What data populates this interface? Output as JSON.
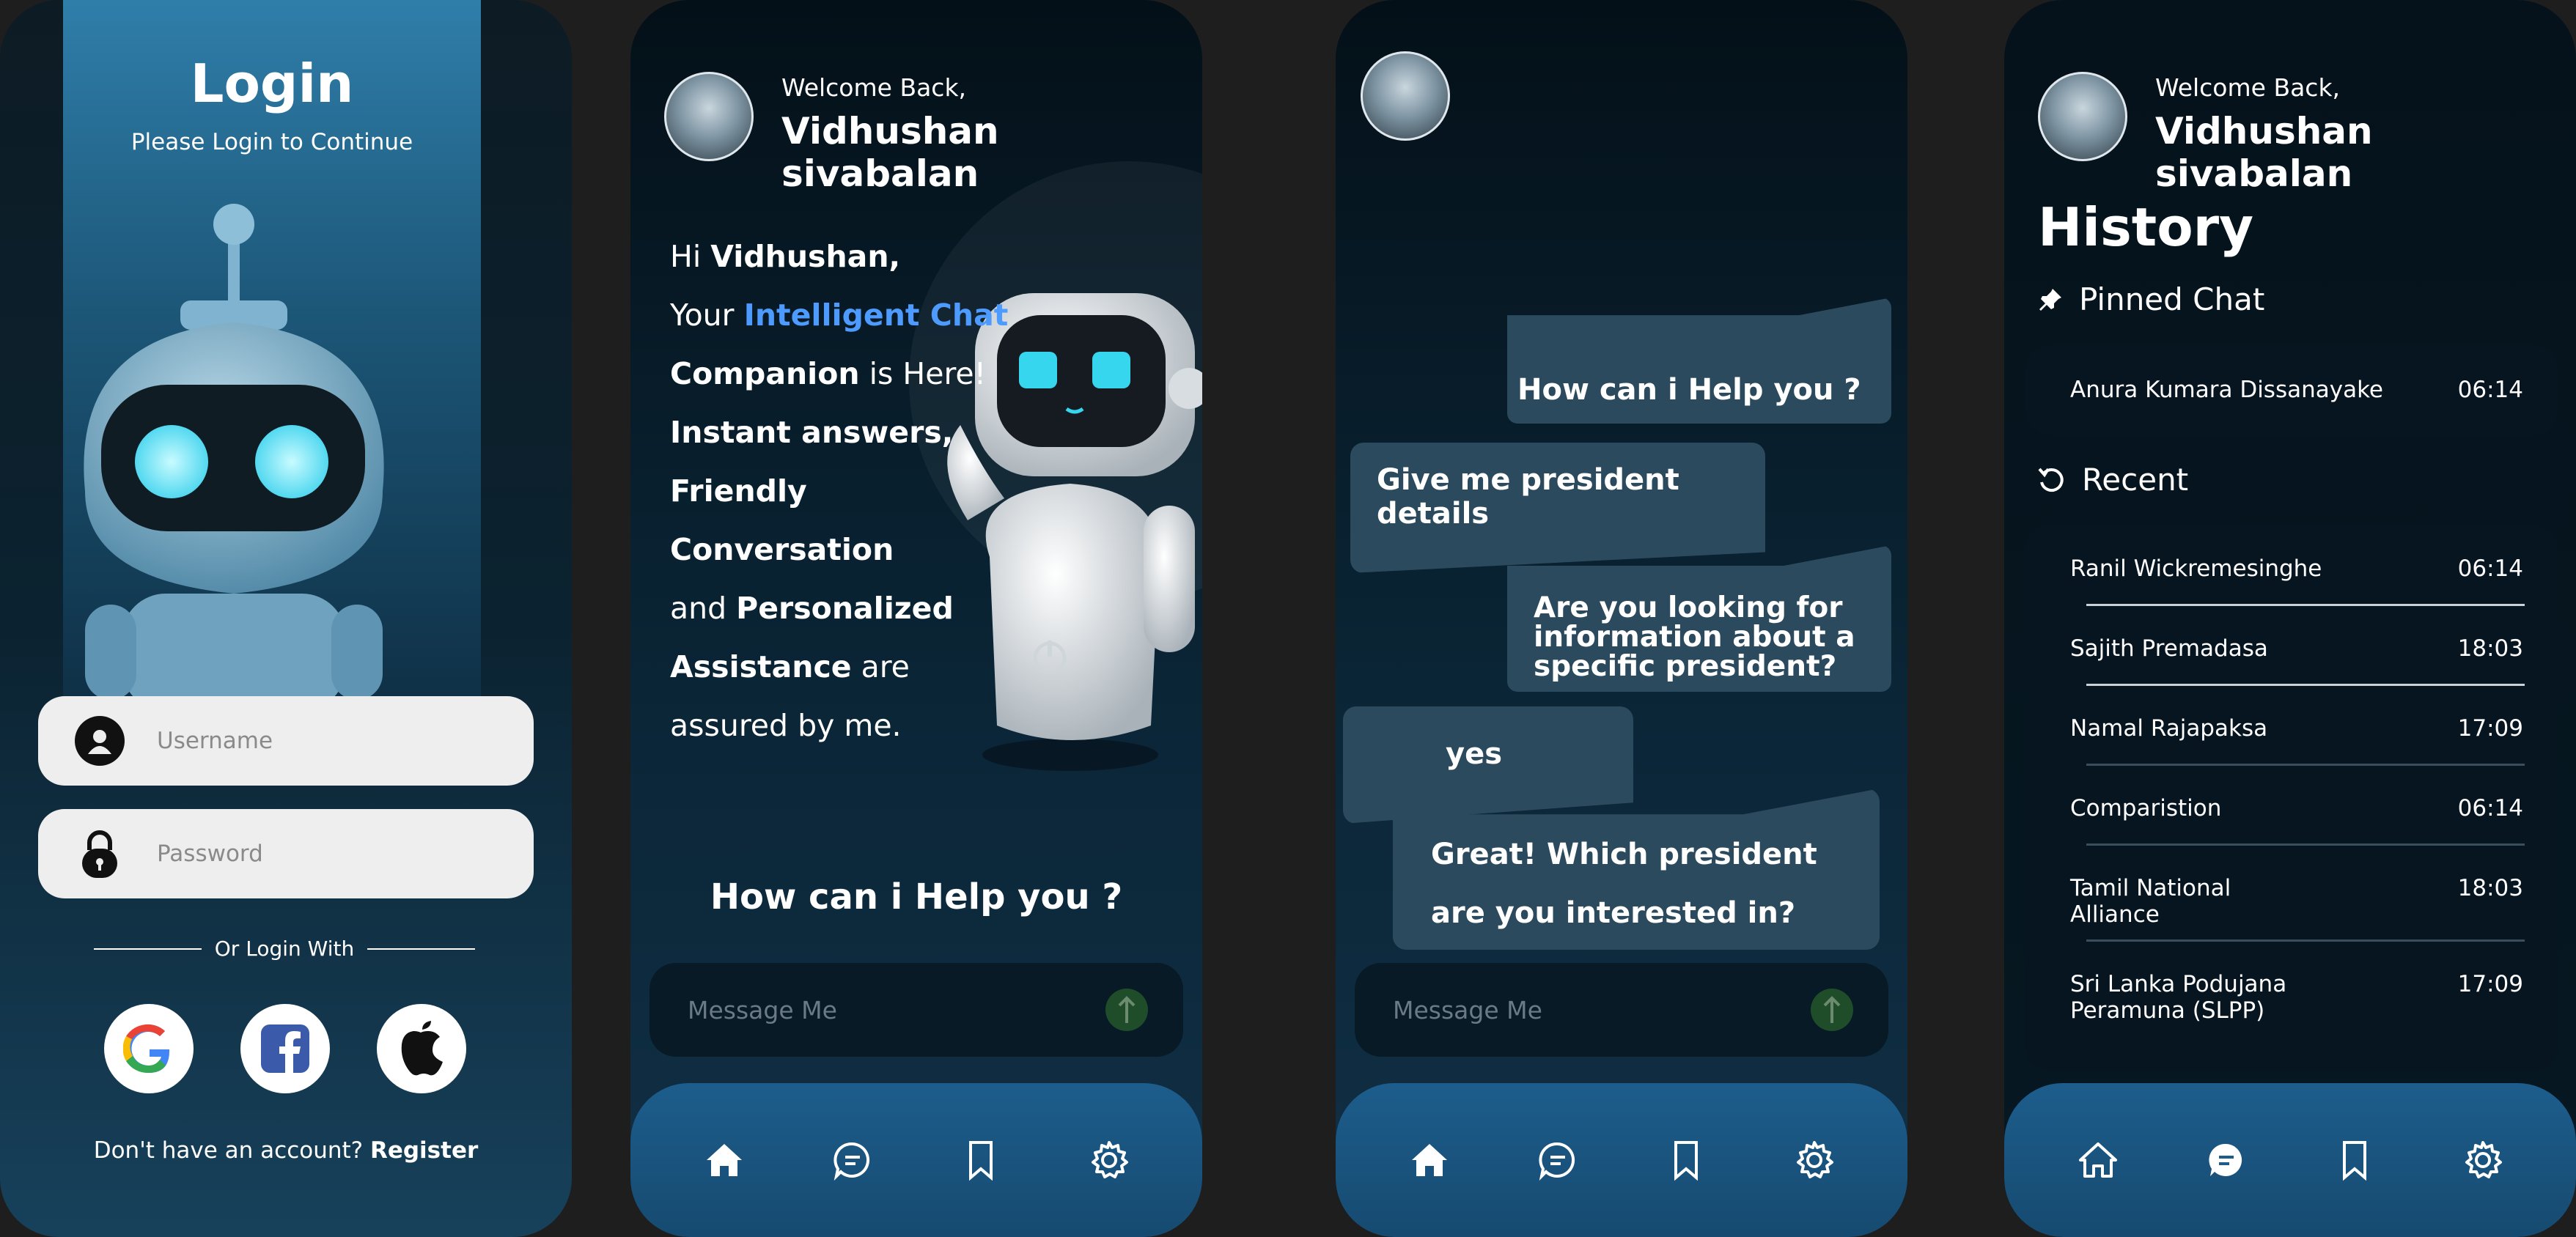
{
  "login": {
    "title": "Login",
    "subtitle": "Please Login to Continue",
    "username_placeholder": "Username",
    "password_placeholder": "Password",
    "or_login_with": "Or Login With",
    "register_prompt": "Don't have an account?",
    "register_link": "Register",
    "social": [
      "google-icon",
      "facebook-icon",
      "apple-icon"
    ]
  },
  "header": {
    "welcome": "Welcome Back,",
    "name": "Vidhushan sivabalan"
  },
  "home": {
    "line1_prefix": "Hi ",
    "line1_name": "Vidhushan,",
    "line2_prefix": "Your ",
    "line2_accent": "Intelligent Chat",
    "line3_bold": "Companion",
    "line3_rest": " is Here!",
    "line4": "Instant answers,",
    "line5": "Friendly",
    "line6": "Conversation",
    "line7_prefix": "and ",
    "line7_bold": "Personalized",
    "line8_bold": "Assistance",
    "line8_rest": " are",
    "line9": "assured by me.",
    "help_prompt": "How can i Help you ?"
  },
  "composer": {
    "placeholder": "Message Me"
  },
  "chat": {
    "messages": [
      {
        "from": "bot",
        "text": "How can i Help you ?"
      },
      {
        "from": "user",
        "text": "Give me president details"
      },
      {
        "from": "bot",
        "text": "Are you looking for information about a specific president?"
      },
      {
        "from": "user",
        "text": "yes"
      },
      {
        "from": "bot",
        "text": "Great! Which president are you interested in?"
      }
    ]
  },
  "history": {
    "title": "History",
    "pinned_label": "Pinned Chat",
    "recent_label": "Recent",
    "pinned": [
      {
        "name": "Anura Kumara Dissanayake",
        "time": "06:14"
      }
    ],
    "recent": [
      {
        "name": "Ranil Wickremesinghe",
        "time": "06:14"
      },
      {
        "name": "Sajith Premadasa",
        "time": "18:03"
      },
      {
        "name": "Namal Rajapaksa",
        "time": "17:09"
      },
      {
        "name": "Comparistion",
        "time": "06:14"
      },
      {
        "name": "Tamil National Alliance",
        "time": "18:03"
      },
      {
        "name": "Sri Lanka Podujana Peramuna (SLPP)",
        "time": "17:09"
      }
    ]
  },
  "tabbar": {
    "tabs": [
      "home-icon",
      "chat-icon",
      "bookmark-icon",
      "settings-icon"
    ]
  },
  "colors": {
    "accent": "#4e9bff",
    "bubble": "#2c4a5d",
    "tabbar": "#1d5d8c",
    "send": "#1f4d2a"
  }
}
